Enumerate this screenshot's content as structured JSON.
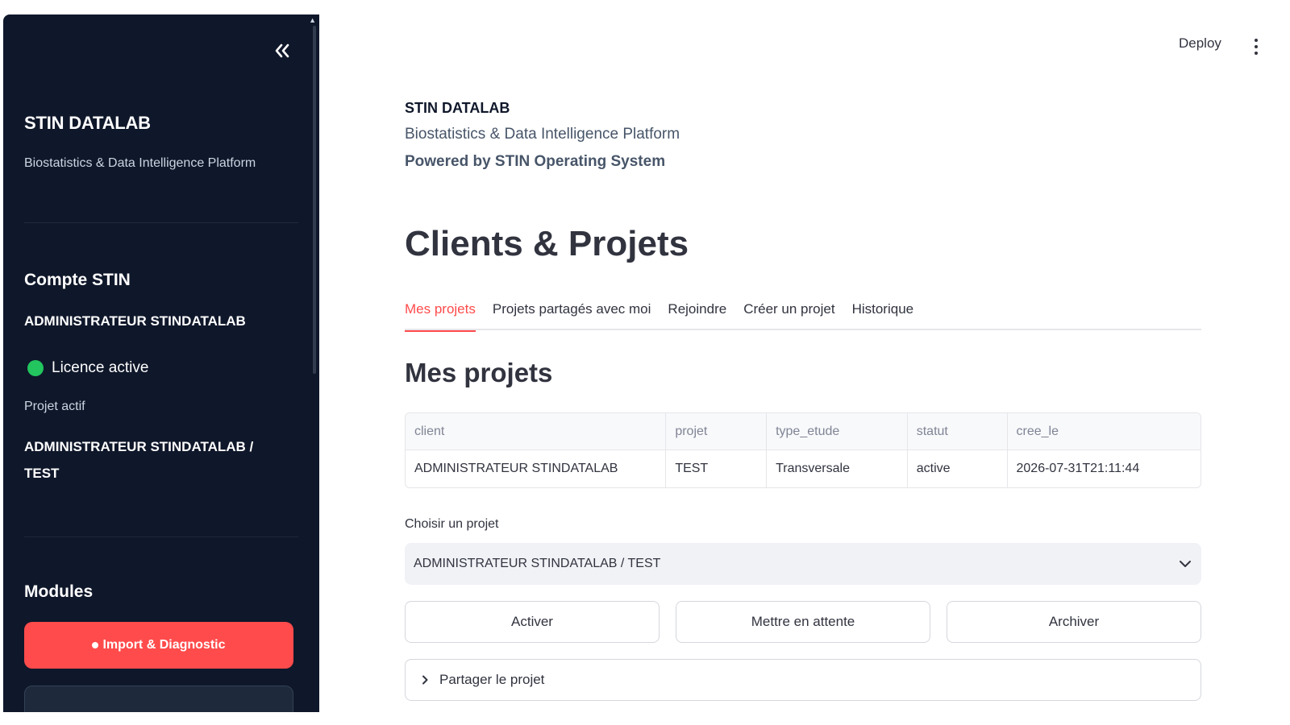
{
  "sidebar": {
    "collapse_icon": "double-chevron-left-icon",
    "title": "STIN DATALAB",
    "subtitle": "Biostatistics & Data Intelligence Platform",
    "account_heading": "Compte STIN",
    "account_name": "ADMINISTRATEUR STINDATALAB",
    "licence_status": "Licence active",
    "licence_color": "#22c55e",
    "active_project_label": "Projet actif",
    "active_project_value": "ADMINISTRATEUR STINDATALAB / TEST",
    "modules_heading": "Modules",
    "modules": [
      {
        "label": "Import & Diagnostic",
        "active": true
      }
    ]
  },
  "header": {
    "deploy_label": "Deploy",
    "menu_icon": "kebab-menu-icon"
  },
  "main": {
    "brand": "STIN DATALAB",
    "brand_subtitle": "Biostatistics & Data Intelligence Platform",
    "powered_by": "Powered by STIN Operating System",
    "page_title": "Clients & Projets",
    "tabs": [
      {
        "label": "Mes projets",
        "active": true
      },
      {
        "label": "Projets partagés avec moi",
        "active": false
      },
      {
        "label": "Rejoindre",
        "active": false
      },
      {
        "label": "Créer un projet",
        "active": false
      },
      {
        "label": "Historique",
        "active": false
      }
    ],
    "section_title": "Mes projets",
    "table": {
      "columns": [
        "client",
        "projet",
        "type_etude",
        "statut",
        "cree_le"
      ],
      "rows": [
        [
          "ADMINISTRATEUR STINDATALAB",
          "TEST",
          "Transversale",
          "active",
          "2026-07-31T21:11:44"
        ]
      ]
    },
    "select": {
      "label": "Choisir un projet",
      "value": "ADMINISTRATEUR STINDATALAB / TEST"
    },
    "actions": {
      "activate": "Activer",
      "hold": "Mettre en attente",
      "archive": "Archiver"
    },
    "expander": {
      "label": "Partager le projet"
    }
  },
  "colors": {
    "accent": "#ff4b4b",
    "sidebar_bg": "#0f172a"
  }
}
